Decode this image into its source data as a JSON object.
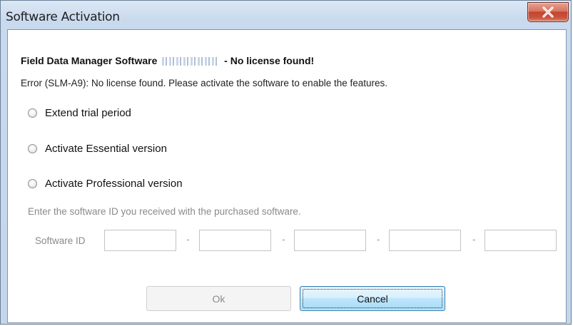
{
  "window": {
    "title": "Software Activation",
    "close_label": "X"
  },
  "content": {
    "heading_prefix": "Field Data Manager Software",
    "heading_suffix": "- No license found!",
    "error_text": "Error (SLM-A9): No license found. Please activate the software to enable the features."
  },
  "options": [
    {
      "label": "Extend trial period",
      "selected": false
    },
    {
      "label": "Activate Essential version",
      "selected": false
    },
    {
      "label": "Activate Professional version",
      "selected": false
    }
  ],
  "software_id": {
    "hint": "Enter the software ID you received with the purchased software.",
    "label": "Software ID",
    "separator": "-",
    "values": [
      "",
      "",
      "",
      "",
      ""
    ]
  },
  "buttons": {
    "ok_label": "Ok",
    "cancel_label": "Cancel"
  }
}
